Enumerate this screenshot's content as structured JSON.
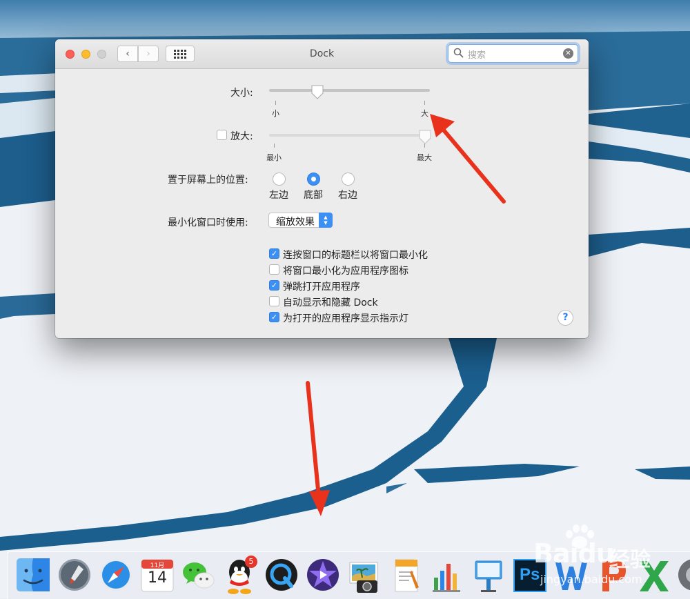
{
  "window": {
    "title": "Dock",
    "search_placeholder": "搜索",
    "nav": {
      "back": "‹",
      "forward": "›"
    },
    "traffic_lights": [
      "close",
      "minimize",
      "zoom"
    ]
  },
  "size": {
    "label": "大小:",
    "min_label": "小",
    "max_label": "大",
    "value_fraction": 0.3
  },
  "magnification": {
    "label": "放大:",
    "checked": false,
    "min_label": "最小",
    "max_label": "最大",
    "value_fraction": 0.97
  },
  "position": {
    "label": "置于屏幕上的位置:",
    "options": [
      {
        "label": "左边",
        "selected": false
      },
      {
        "label": "底部",
        "selected": true
      },
      {
        "label": "右边",
        "selected": false
      }
    ]
  },
  "minimize": {
    "label": "最小化窗口时使用:",
    "selected": "缩放效果"
  },
  "checkboxes": [
    {
      "label": "连按窗口的标题栏以将窗口最小化",
      "checked": true
    },
    {
      "label": "将窗口最小化为应用程序图标",
      "checked": false
    },
    {
      "label": "弹跳打开应用程序",
      "checked": true
    },
    {
      "label": "自动显示和隐藏 Dock",
      "checked": false
    },
    {
      "label": "为打开的应用程序显示指示灯",
      "checked": true
    }
  ],
  "help": "?",
  "dock": {
    "calendar_month": "11月",
    "calendar_day": "14",
    "qq_badge": "5",
    "photoshop_label": "Ps"
  },
  "watermark": {
    "brand": "Baidu",
    "brand_cn": "经验",
    "url": "jingyan.baidu.com"
  },
  "colors": {
    "accent": "#3d8ff2",
    "arrow": "#e8321c",
    "water": "#1b5f8f"
  }
}
